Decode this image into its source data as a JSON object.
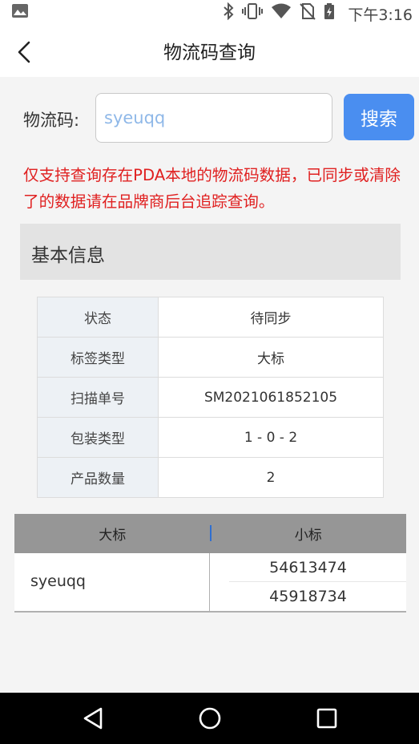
{
  "status_bar": {
    "time": "下午3:16",
    "icons": [
      "gallery-icon",
      "bluetooth-icon",
      "vibrate-icon",
      "wifi-icon",
      "no-sim-icon",
      "battery-charging-icon"
    ]
  },
  "header": {
    "title": "物流码查询",
    "back_icon": "back-arrow-icon"
  },
  "search": {
    "label": "物流码:",
    "value": "syeuqq",
    "button_label": "搜索"
  },
  "notice": "仅支持查询存在PDA本地的物流码数据，已同步或清除了的数据请在品牌商后台追踪查询。",
  "basic_info": {
    "section_title": "基本信息",
    "rows": [
      {
        "key": "状态",
        "value": "待同步"
      },
      {
        "key": "标签类型",
        "value": "大标"
      },
      {
        "key": "扫描单号",
        "value": "SM2021061852105"
      },
      {
        "key": "包装类型",
        "value": "1 - 0 - 2"
      },
      {
        "key": "产品数量",
        "value": "2"
      }
    ]
  },
  "tag_table": {
    "headers": [
      "大标",
      "小标"
    ],
    "rows": [
      {
        "big": "syeuqq",
        "small": [
          "54613474",
          "45918734"
        ]
      }
    ]
  },
  "nav_bar": {
    "buttons": [
      "back-triangle-icon",
      "home-circle-icon",
      "recents-square-icon"
    ]
  },
  "colors": {
    "accent": "#4a8ef0",
    "notice": "#e02020",
    "section_bg": "#e3e3e3",
    "table_header": "#969696"
  }
}
